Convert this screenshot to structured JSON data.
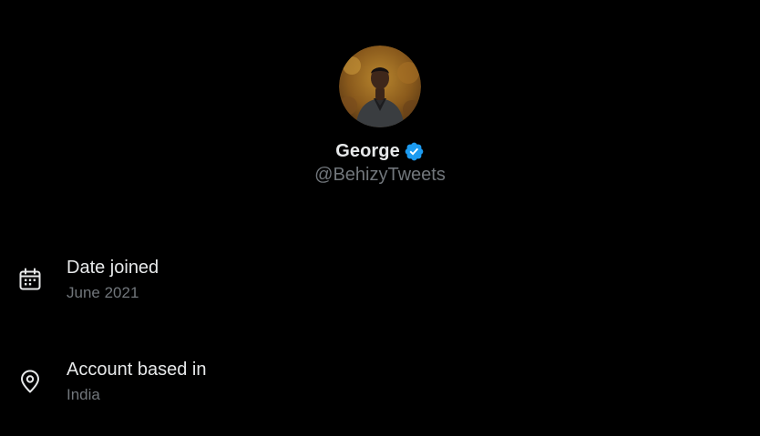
{
  "profile": {
    "display_name": "George",
    "handle": "@BehizyTweets",
    "avatar_icon": "profile-photo",
    "verified_icon": "verified-badge-icon",
    "verified_color": "#1d9bf0"
  },
  "details": {
    "date_joined": {
      "icon": "calendar-icon",
      "label": "Date joined",
      "value": "June 2021"
    },
    "account_based_in": {
      "icon": "location-pin-icon",
      "label": "Account based in",
      "value": "India"
    }
  },
  "colors": {
    "background": "#000000",
    "primary_text": "#e7e9ea",
    "secondary_text": "#71767b"
  }
}
